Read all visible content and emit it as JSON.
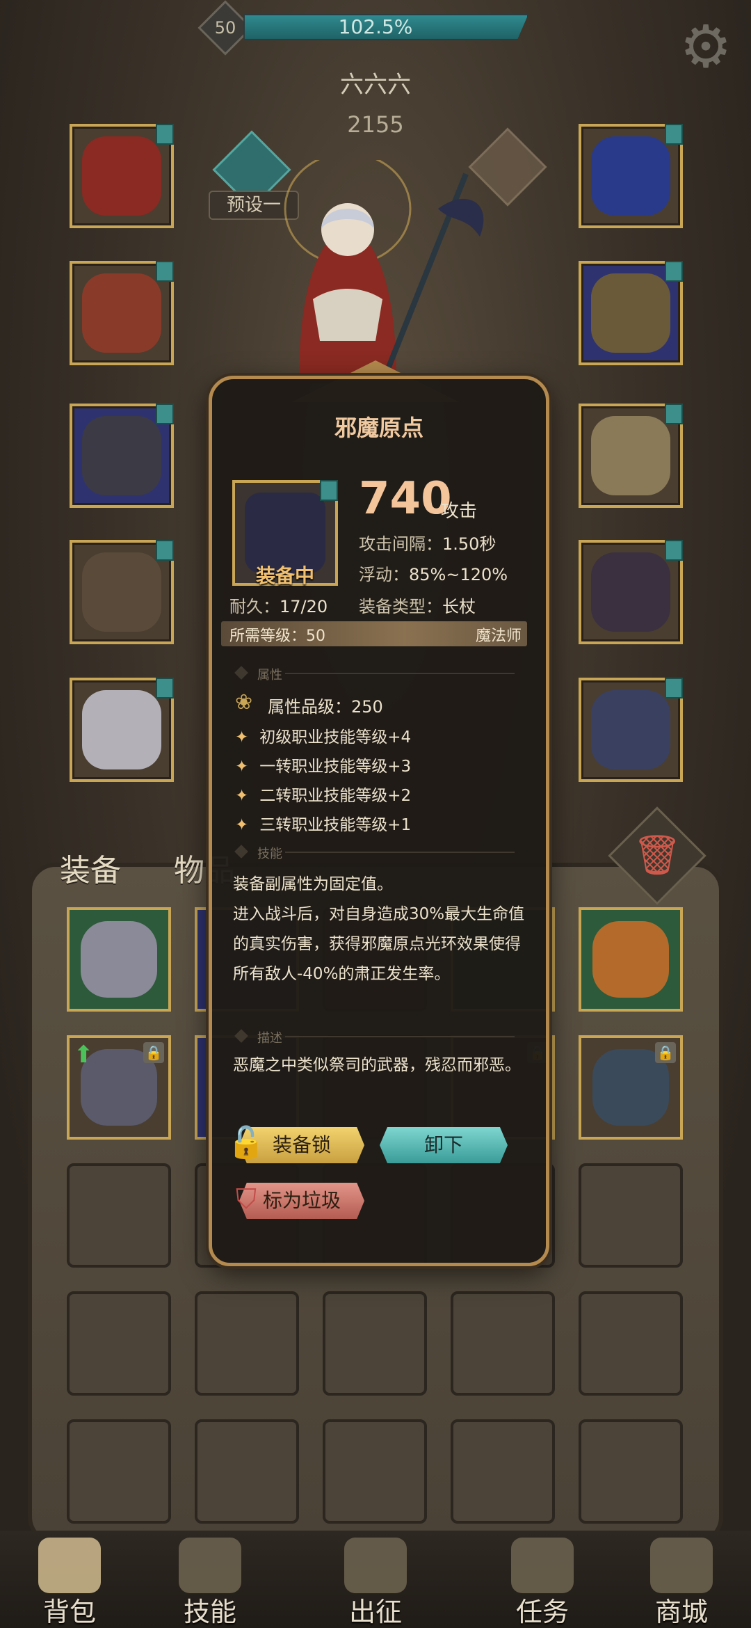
{
  "top_bar": {
    "level": "50",
    "xp_percent": "102.5%",
    "xp_fill": 1.0
  },
  "player": {
    "name": "六六六",
    "power": "2155",
    "preset_label": "预设一"
  },
  "tabs": {
    "equipment": "装备",
    "items": "物品"
  },
  "item_popup": {
    "title": "邪魔原点",
    "equipped_label": "装备中",
    "attack_value": "740",
    "attack_unit": "攻击",
    "attack_interval_label": "攻击间隔：",
    "attack_interval_value": "1.50秒",
    "float_label": "浮动：",
    "float_value": "85%~120%",
    "durability_label": "耐久：",
    "durability_value": "17/20",
    "equip_type_label": "装备类型：",
    "equip_type_value": "长杖",
    "required_level_label": "所需等级：",
    "required_level_value": "50",
    "required_class": "魔法师",
    "section_attributes": "属性",
    "attribute_grade_label": "属性品级：",
    "attribute_grade_value": "250",
    "attributes": [
      "初级职业技能等级+4",
      "一转职业技能等级+3",
      "二转职业技能等级+2",
      "三转职业技能等级+1"
    ],
    "section_skill": "技能",
    "skill_text_1": "装备副属性为固定值。",
    "skill_text_2": "进入战斗后，对自身造成30%最大生命值的真实伤害，获得邪魔原点光环效果使得所有敌人-40%的肃正发生率。",
    "section_description": "描述",
    "description_text": "恶魔之中类似祭司的武器，残忍而邪恶。",
    "lock_button": "装备锁",
    "unequip_button": "卸下",
    "mark_trash_button": "标为垃圾"
  },
  "bottom_nav": [
    {
      "label": "背包",
      "icon": "backpack-icon"
    },
    {
      "label": "技能",
      "icon": "skill-book-icon"
    },
    {
      "label": "出征",
      "icon": "sword-map-icon"
    },
    {
      "label": "任务",
      "icon": "scroll-icon"
    },
    {
      "label": "商城",
      "icon": "shop-crown-icon"
    }
  ],
  "colors": {
    "accent_gold": "#c9a655",
    "accent_teal": "#3a9c98",
    "popup_title": "#f0c9a0"
  }
}
